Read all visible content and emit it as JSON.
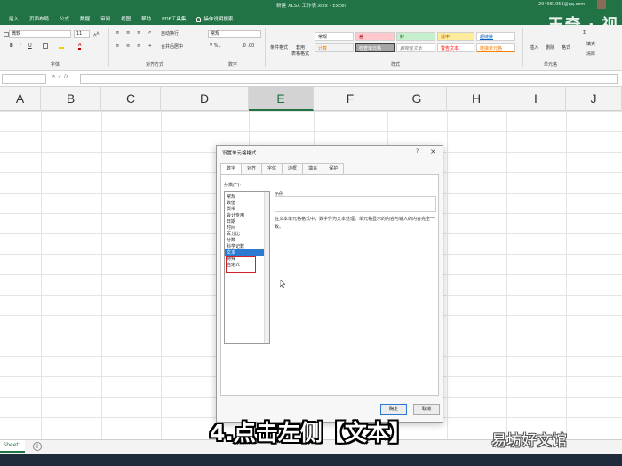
{
  "window": {
    "title": "新建 XLSX 工作表.xlsx  -  Excel",
    "account": "294981053@qq.com",
    "top_watermark": "王奇 · 视"
  },
  "ribbon_tabs": [
    "插入",
    "页面布局",
    "公式",
    "数据",
    "审阅",
    "视图",
    "帮助",
    "PDF工具集",
    "操作说明搜索"
  ],
  "ribbon": {
    "font_name": "微软",
    "font_size": "11",
    "wrap_text": "自动换行",
    "merge_center": "合并后居中",
    "number_format": "常规",
    "conditional_format": "条件格式",
    "format_as_table": "套用\n表格格式",
    "styles": {
      "normal": "常规",
      "bad": "差",
      "good": "好",
      "neutral": "适中",
      "hyperlink": "超链接",
      "calculation": "计算",
      "check_cell": "检查单元格",
      "explanatory": "解释性文本",
      "warning": "警告文本",
      "followed_link": "链接单元格"
    },
    "insert": "插入",
    "delete": "删除",
    "format": "格式",
    "fill": "填充",
    "clear": "清除",
    "group_labels": {
      "font": "字体",
      "alignment": "对齐方式",
      "number": "数字",
      "styles": "样式",
      "cells": "单元格"
    }
  },
  "columns": [
    "A",
    "B",
    "C",
    "D",
    "E",
    "F",
    "G",
    "H",
    "I",
    "J"
  ],
  "selected_column": "E",
  "dialog": {
    "title": "设置单元格格式",
    "help": "?",
    "close": "×",
    "tabs": [
      "数字",
      "对齐",
      "字体",
      "边框",
      "填充",
      "保护"
    ],
    "active_tab": "数字",
    "category_label": "分类(C):",
    "categories": [
      "常规",
      "数值",
      "货币",
      "会计专用",
      "日期",
      "时间",
      "百分比",
      "分数",
      "科学记数",
      "文本",
      "特殊",
      "自定义"
    ],
    "selected_category": "文本",
    "sample_label": "示例",
    "description": "在文本单元格格式中，数字作为文本处理。单元格显示的内容与输入的内容完全一致。",
    "ok": "确定",
    "cancel": "取消"
  },
  "sheet": {
    "tab": "Sheet1",
    "add": "+"
  },
  "overlay": {
    "caption": "4.点击左侧【文本】",
    "watermark": "易坊好文馆"
  },
  "colors": {
    "excel_green": "#217346",
    "selection_blue": "#2a7ad2",
    "highlight_red": "#d0202a"
  }
}
